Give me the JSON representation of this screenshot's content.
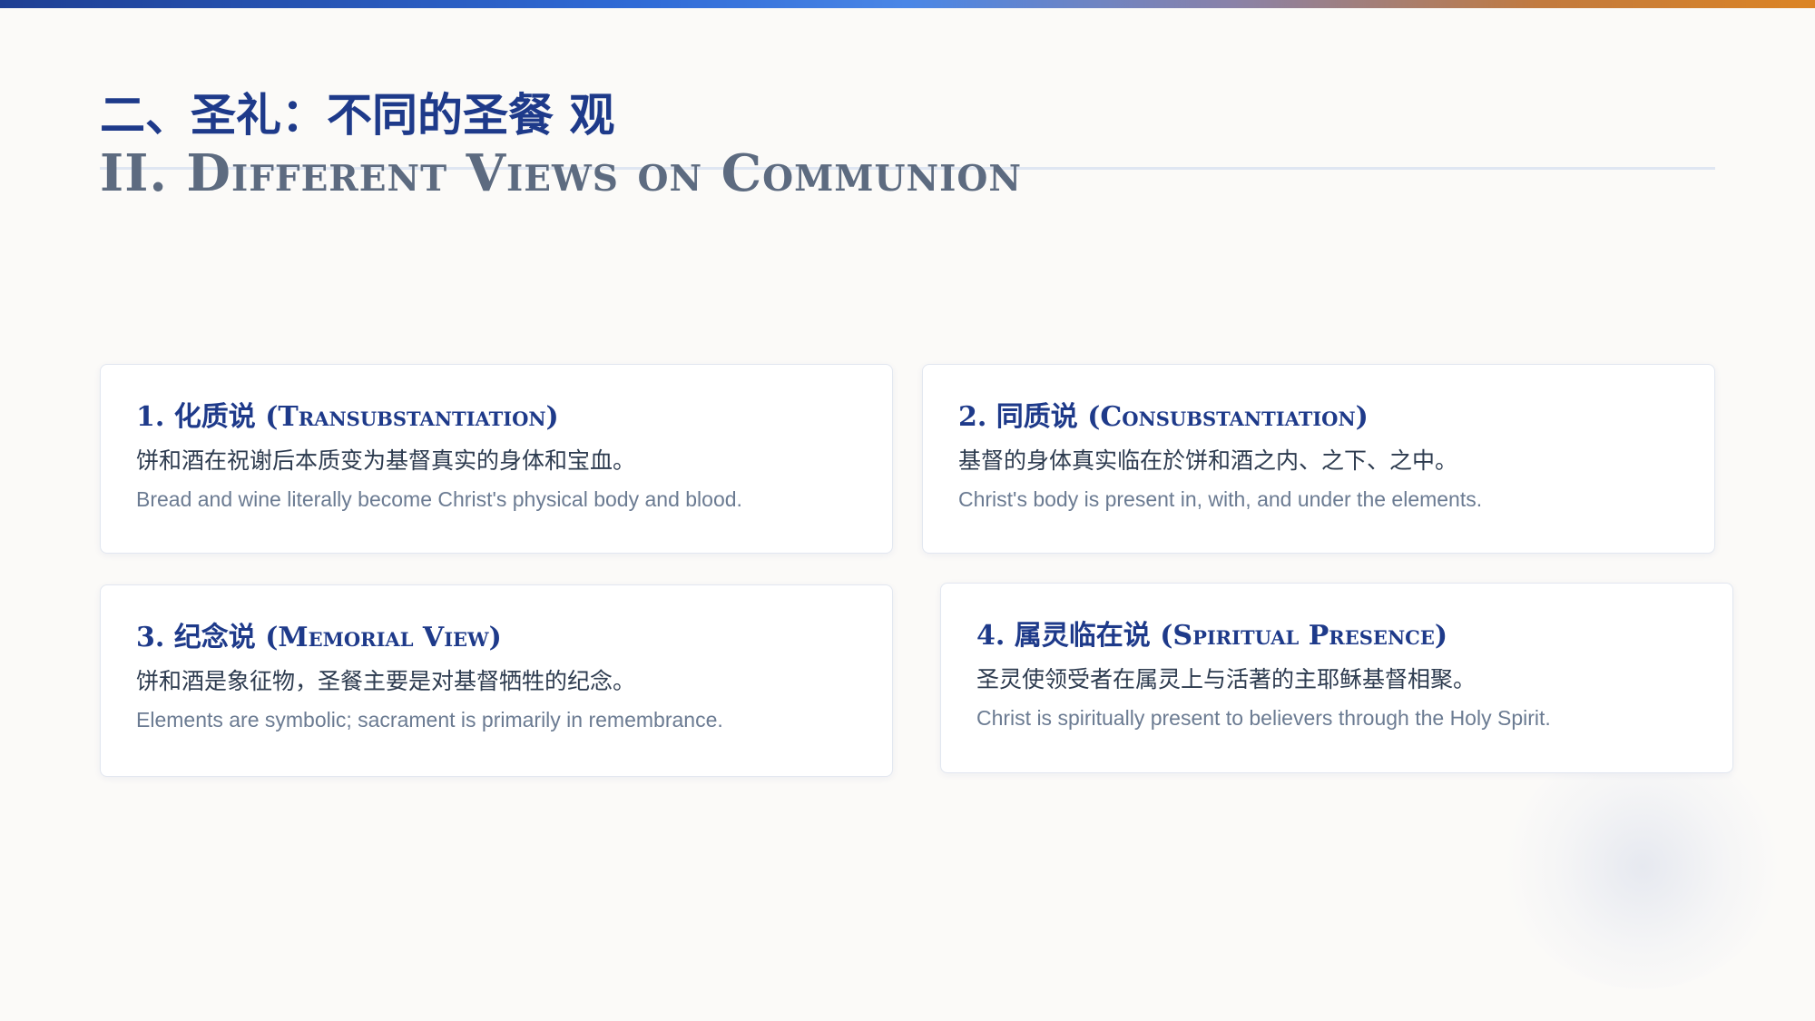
{
  "header": {
    "title_cn": "二、圣礼：不同的圣餐 观",
    "title_en": "II. Different Views on Communion"
  },
  "cards": [
    {
      "title": "1. 化质说 (Transubstantiation)",
      "desc_cn": "饼和酒在祝谢后本质变为基督真实的身体和宝血。",
      "desc_en": "Bread and wine literally become Christ's physical body and blood."
    },
    {
      "title": "2. 同质说 (Consubstantiation)",
      "desc_cn": "基督的身体真实临在於饼和酒之内、之下、之中。",
      "desc_en": "Christ's body is present in, with, and under the elements."
    },
    {
      "title": "3. 纪念说 (Memorial View)",
      "desc_cn": "饼和酒是象征物，圣餐主要是对基督牺牲的纪念。",
      "desc_en": "Elements are symbolic; sacrament is primarily in remembrance."
    },
    {
      "title": "4. 属灵临在说 (Spiritual Presence)",
      "desc_cn": "圣灵使领受者在属灵上与活著的主耶稣基督相聚。",
      "desc_en": "Christ is spiritually present to believers through the Holy Spirit."
    }
  ],
  "colors": {
    "accent": "#1e3a8a",
    "subtitle": "#5d6b80",
    "body_text": "#2d3b4f",
    "muted_text": "#6b7b92",
    "background": "#fbfaf8"
  }
}
